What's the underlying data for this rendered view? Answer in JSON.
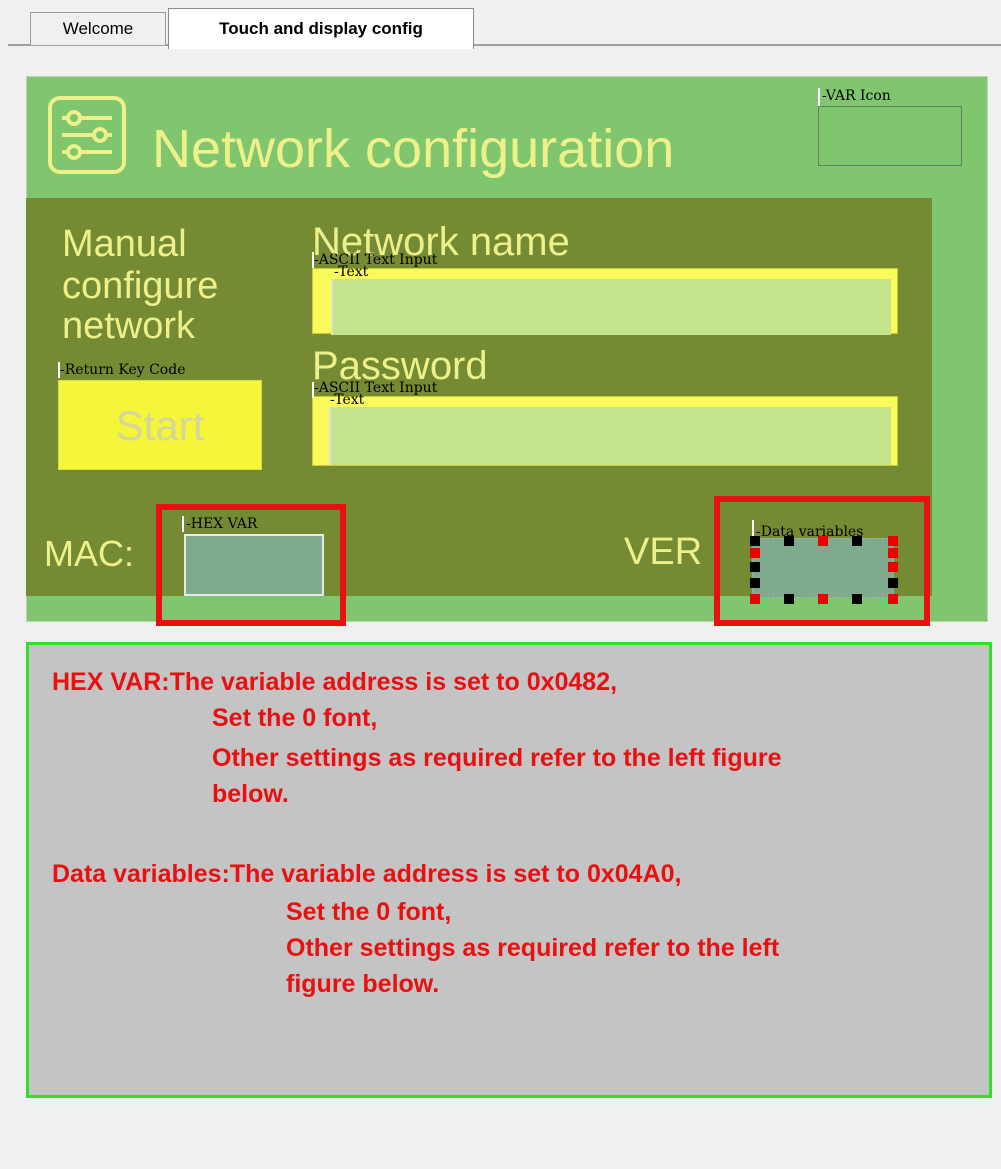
{
  "tabs": {
    "welcome": "Welcome",
    "touch_display": "Touch and display config"
  },
  "panel": {
    "title": "Network configuration",
    "var_icon_label": "-VAR Icon",
    "manual_line1": "Manual",
    "manual_line2": "configure",
    "manual_line3": "network",
    "network_name_label": "Network name",
    "password_label": "Password",
    "ascii_input_label_1": "-ASCII Text Input",
    "text_label_1": "-Text",
    "ascii_input_label_2": "-ASCII Text Input",
    "text_label_2": "-Text",
    "return_key_label": "-Return Key Code",
    "start_label": "Start",
    "mac_label": "MAC:",
    "hex_var_label": "-HEX VAR",
    "ver_label": "VER",
    "data_variables_label": "-Data variables"
  },
  "note": {
    "hex_line1": "HEX VAR:The variable address is set to 0x0482,",
    "hex_line2": "Set the 0 font,",
    "hex_line3": "Other settings as required refer to the left figure",
    "hex_line4": "below.",
    "data_line1": "Data variables:The variable address is set to 0x04A0,",
    "data_line2": "Set the 0 font,",
    "data_line3": "Other settings as required refer to the left",
    "data_line4": "figure below."
  },
  "colors": {
    "panel_green": "#7fc66e",
    "inner_olive": "#748b34",
    "text_yellow": "#eef08a",
    "highlight_red": "#e81010",
    "note_border_green": "#33dd33"
  },
  "icons": {
    "config": "sliders-icon"
  }
}
